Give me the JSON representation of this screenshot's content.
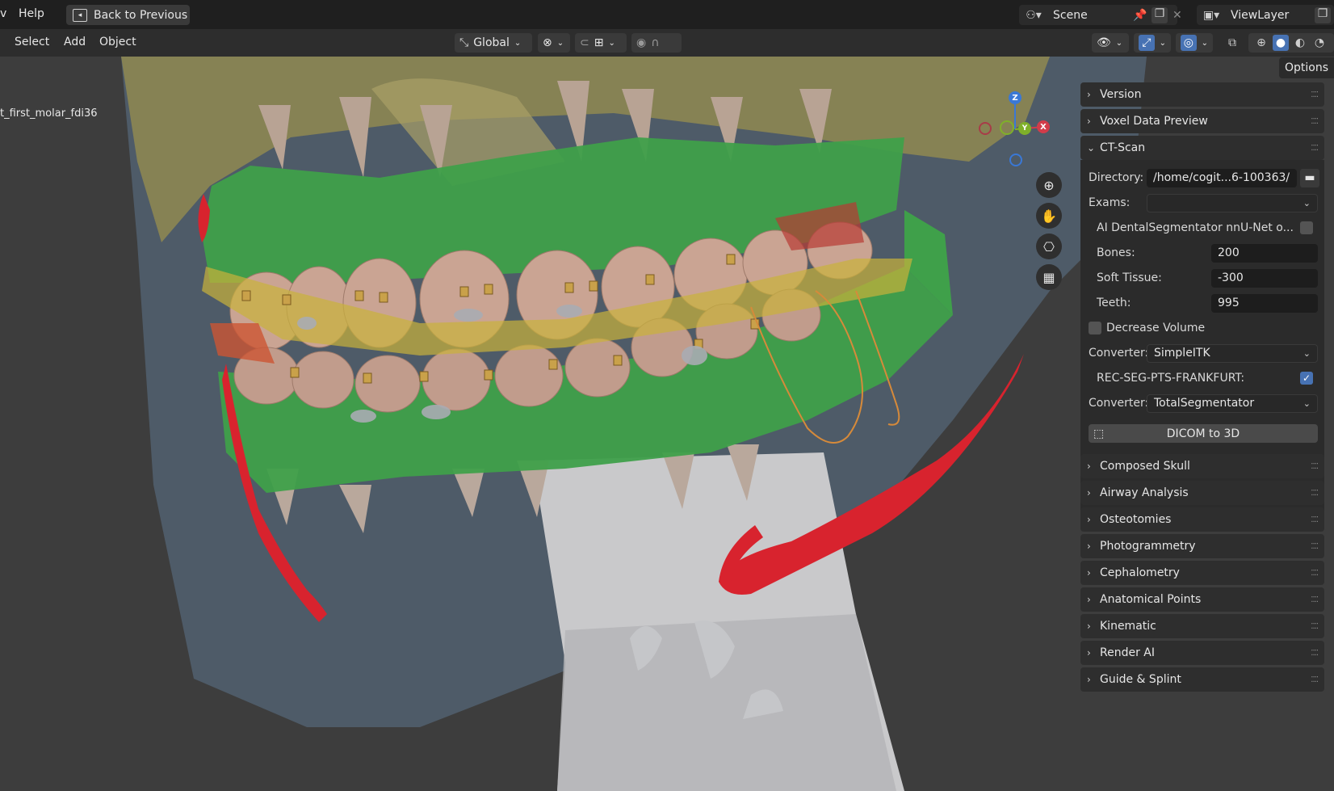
{
  "topbar": {
    "menu_partial": "v",
    "help": "Help",
    "back_button": "Back to Previous",
    "scene_label": "Scene",
    "view_layer_label": "ViewLayer"
  },
  "toolbar": {
    "select": "Select",
    "add": "Add",
    "object": "Object",
    "orientation": "Global"
  },
  "viewport": {
    "object_name": "t_first_molar_fdi36",
    "gizmo": {
      "z": "Z",
      "y": "Y",
      "x": "X"
    }
  },
  "options_tab": "Options",
  "panel": {
    "sections_top": [
      {
        "label": "Version",
        "collapsed": true
      },
      {
        "label": "Voxel Data Preview",
        "collapsed": true
      }
    ],
    "ct_scan": {
      "title": "CT-Scan",
      "directory_label": "Directory:",
      "directory_value": "/home/cogit...6-100363/",
      "exams_label": "Exams:",
      "exams_value": "",
      "ai_label": "AI DentalSegmentator nnU-Net o...",
      "ai_checked": false,
      "bones_label": "Bones:",
      "bones_value": "200",
      "soft_tissue_label": "Soft Tissue:",
      "soft_tissue_value": "-300",
      "teeth_label": "Teeth:",
      "teeth_value": "995",
      "decrease_volume_label": "Decrease Volume",
      "decrease_volume_checked": false,
      "converter1_label": "Converter:",
      "converter1_value": "SimpleITK",
      "rec_label": "REC-SEG-PTS-FRANKFURT:",
      "rec_checked": true,
      "converter2_label": "Converter:",
      "converter2_value": "TotalSegmentator",
      "dicom_button": "DICOM to 3D"
    },
    "sections_bottom": [
      {
        "label": "Composed Skull"
      },
      {
        "label": "Airway Analysis"
      },
      {
        "label": "Osteotomies"
      },
      {
        "label": "Photogrammetry"
      },
      {
        "label": "Cephalometry"
      },
      {
        "label": "Anatomical Points"
      },
      {
        "label": "Kinematic"
      },
      {
        "label": "Render AI"
      },
      {
        "label": "Guide & Splint"
      }
    ]
  },
  "colors": {
    "accent": "#4772b3",
    "gingiva": "#3fa04a",
    "nerve": "#d8232e",
    "bone": "#c7ba74"
  }
}
